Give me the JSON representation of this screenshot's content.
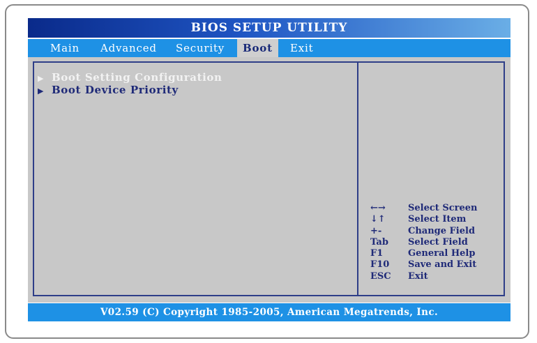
{
  "title": "BIOS SETUP UTILITY",
  "tabs": [
    {
      "label": "Main"
    },
    {
      "label": "Advanced"
    },
    {
      "label": "Security"
    },
    {
      "label": "Boot"
    },
    {
      "label": "Exit"
    }
  ],
  "active_tab": "Boot",
  "menu": {
    "items": [
      {
        "label": "Boot Setting Configuration"
      },
      {
        "label": "Boot Device Priority"
      }
    ]
  },
  "help": [
    {
      "key": "←→",
      "desc": "Select Screen"
    },
    {
      "key": "↓↑",
      "desc": "Select Item"
    },
    {
      "key": "+-",
      "desc": "Change Field"
    },
    {
      "key": "Tab",
      "desc": "Select Field"
    },
    {
      "key": "F1",
      "desc": "General Help"
    },
    {
      "key": "F10",
      "desc": "Save and Exit"
    },
    {
      "key": "ESC",
      "desc": "Exit"
    }
  ],
  "footer": "V02.59 (C) Copyright 1985-2005, American Megatrends, Inc.",
  "colors": {
    "title_gradient_start": "#0a2a8a",
    "title_gradient_end": "#6aaee6",
    "menubar": "#1e91e5",
    "panel": "#c8c8c8",
    "text_dark": "#1f2a78"
  }
}
